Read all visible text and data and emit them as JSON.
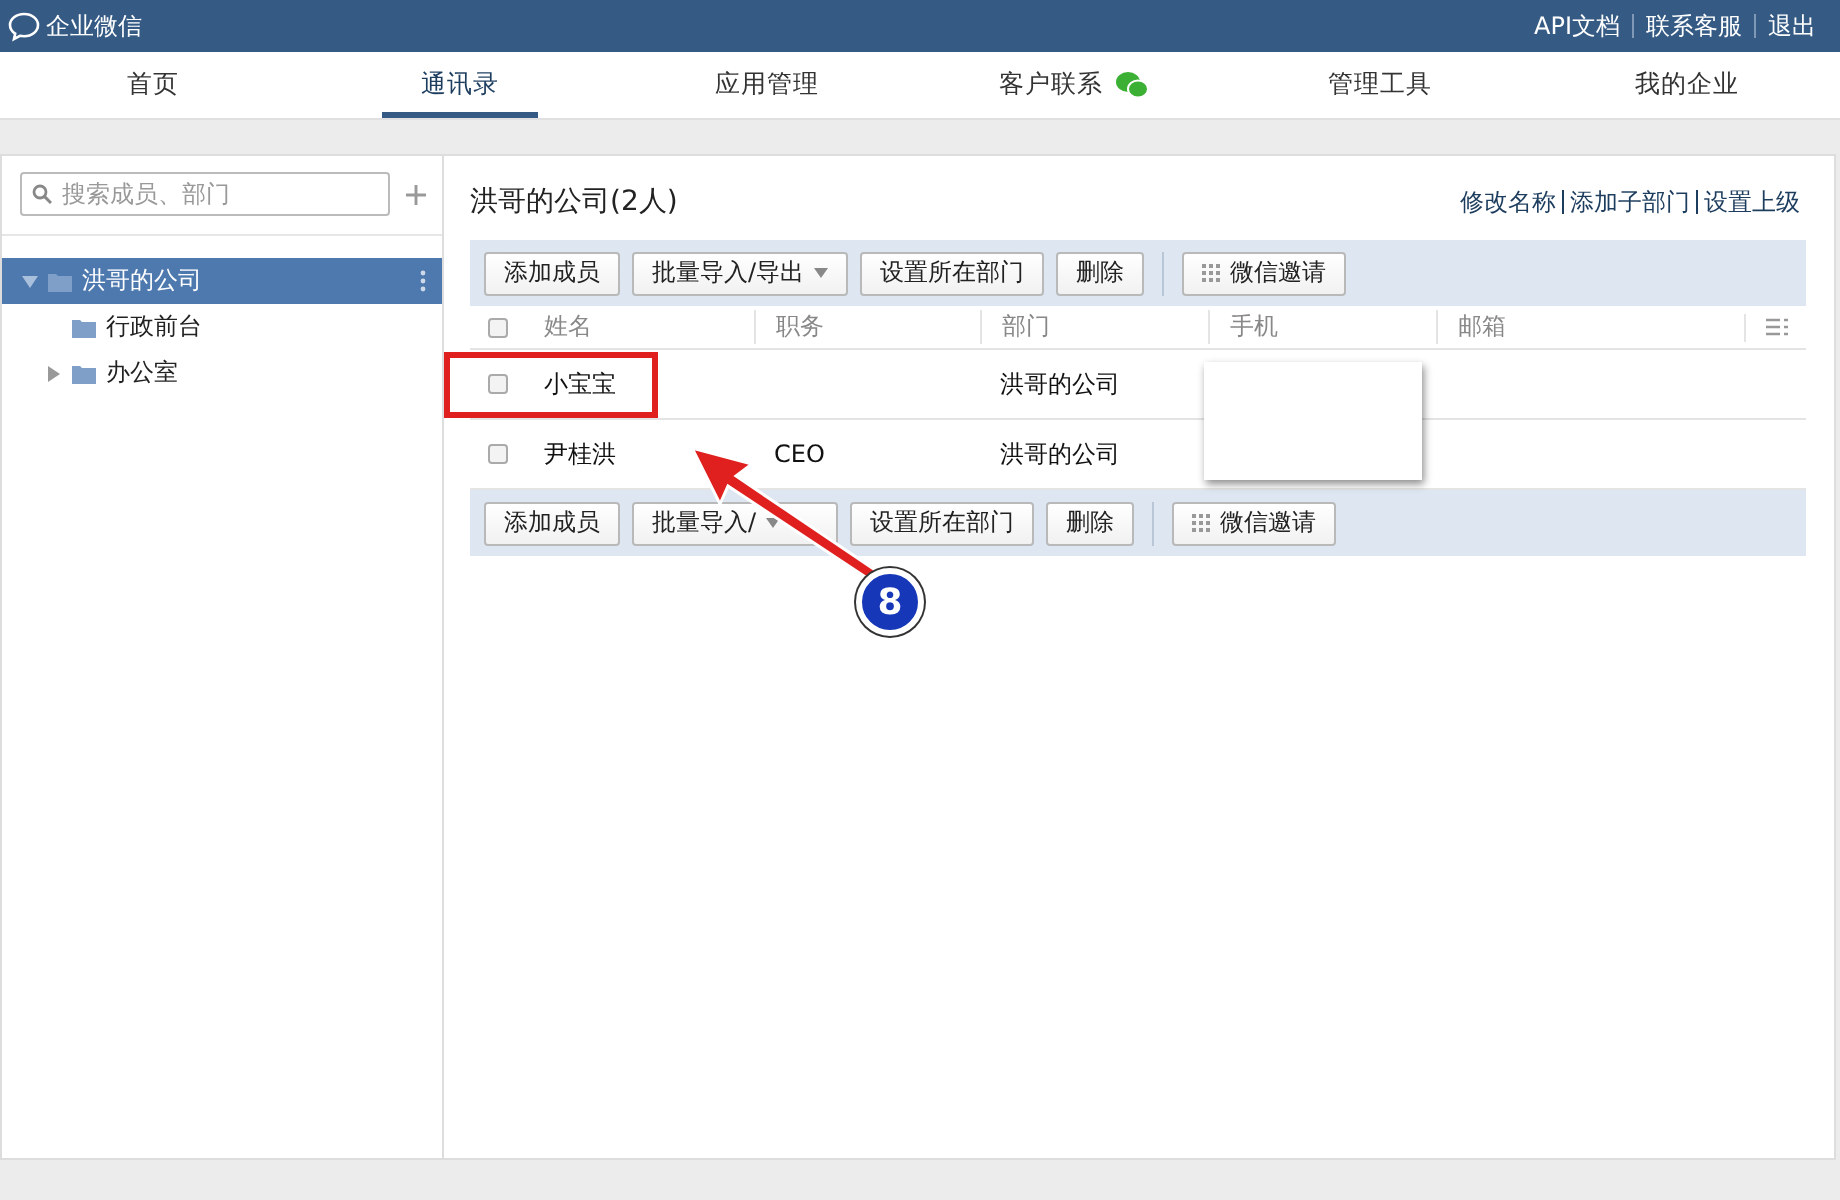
{
  "header": {
    "logo": "企业微信",
    "links": [
      "API文档",
      "联系客服",
      "退出"
    ]
  },
  "nav": [
    {
      "label": "首页",
      "selected": false,
      "kind": "plain"
    },
    {
      "label": "通讯录",
      "selected": true,
      "kind": "plain"
    },
    {
      "label": "应用管理",
      "selected": false,
      "kind": "plain"
    },
    {
      "label": "客户联系",
      "selected": false,
      "kind": "wechat"
    },
    {
      "label": "管理工具",
      "selected": false,
      "kind": "plain"
    },
    {
      "label": "我的企业",
      "selected": false,
      "kind": "plain"
    }
  ],
  "sidebar": {
    "search": {
      "placeholder": "搜索成员、部门"
    },
    "tree": [
      {
        "label": "洪哥的公司",
        "expanded": true,
        "selected": true,
        "children": [
          {
            "label": "行政前台",
            "selected": false
          },
          {
            "label": "办公室",
            "expanded": false,
            "selected": false
          }
        ]
      }
    ]
  },
  "content": {
    "title": "洪哥的公司(2人)",
    "links": [
      "修改名称",
      "添加子部门",
      "设置上级"
    ],
    "toolbar": [
      {
        "label": "添加成员",
        "kind": "plain"
      },
      {
        "label": "批量导入/导出",
        "kind": "dropdown"
      },
      {
        "label": "设置所在部门",
        "kind": "plain"
      },
      {
        "label": "删除",
        "kind": "plain"
      },
      {
        "label": "微信邀请",
        "kind": "qr"
      }
    ],
    "bottom_toolbar": [
      {
        "label": "添加成员",
        "kind": "plain"
      },
      {
        "label": "批量导入/",
        "kind": "dropdown"
      },
      {
        "label": "设置所在部门",
        "kind": "plain"
      },
      {
        "label": "删除",
        "kind": "plain"
      },
      {
        "label": "微信邀请",
        "kind": "qr"
      }
    ],
    "all_checked": false,
    "columns": [
      "姓名",
      "职务",
      "部门",
      "手机",
      "邮箱"
    ],
    "rows": [
      {
        "checked": false,
        "cells": [
          "小宝宝",
          "",
          "洪哥的公司",
          "",
          ""
        ],
        "highlighted": true
      },
      {
        "checked": false,
        "cells": [
          "尹桂洪",
          "CEO",
          "洪哥的公司",
          "",
          ""
        ],
        "highlighted": false
      }
    ]
  },
  "annotation": {
    "step": "8"
  }
}
